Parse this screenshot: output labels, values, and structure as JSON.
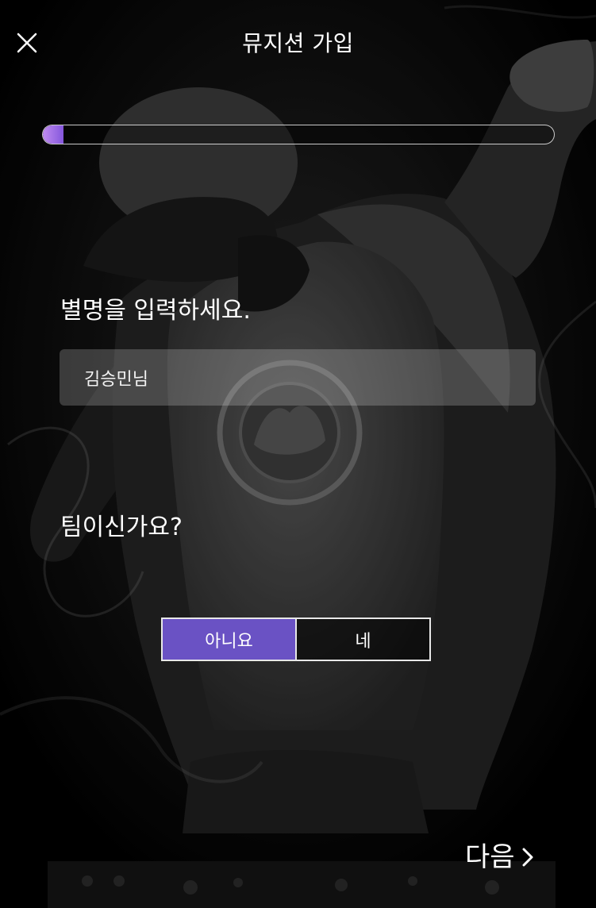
{
  "header": {
    "title": "뮤지션 가입",
    "close_icon": "close-icon"
  },
  "progress": {
    "value": 0.04
  },
  "nickname": {
    "label": "별명을 입력하세요.",
    "value": "김승민님"
  },
  "team": {
    "question": "팀이신가요?",
    "options": [
      {
        "label": "아니요",
        "selected": true
      },
      {
        "label": "네",
        "selected": false
      }
    ]
  },
  "footer": {
    "next_label": "다음",
    "next_icon": "chevron-right-icon"
  },
  "colors": {
    "accent": "#6a52c4",
    "progress_fill_start": "#c08cf0",
    "progress_fill_end": "#8456dc",
    "text": "#ffffff"
  }
}
